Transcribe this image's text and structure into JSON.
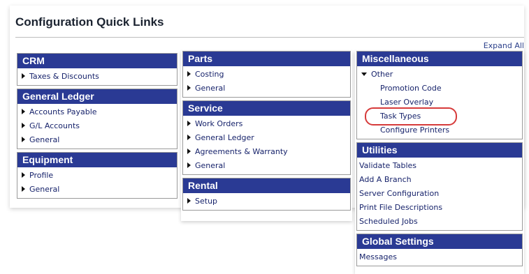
{
  "page": {
    "title": "Configuration Quick Links",
    "expand_all": "Expand All"
  },
  "sections": {
    "crm": {
      "title": "CRM",
      "items": [
        "Taxes & Discounts"
      ]
    },
    "general_ledger": {
      "title": "General Ledger",
      "items": [
        "Accounts Payable",
        "G/L Accounts",
        "General"
      ]
    },
    "equipment": {
      "title": "Equipment",
      "items": [
        "Profile",
        "General"
      ]
    },
    "parts": {
      "title": "Parts",
      "items": [
        "Costing",
        "General"
      ]
    },
    "service": {
      "title": "Service",
      "items": [
        "Work Orders",
        "General Ledger",
        "Agreements & Warranty",
        "General"
      ]
    },
    "rental": {
      "title": "Rental",
      "items": [
        "Setup"
      ]
    },
    "miscellaneous": {
      "title": "Miscellaneous",
      "group": "Other",
      "items": [
        "Promotion Code",
        "Laser Overlay",
        "Task Types",
        "Configure Printers"
      ]
    },
    "utilities": {
      "title": "Utilities",
      "items": [
        "Validate Tables",
        "Add A Branch",
        "Server Configuration",
        "Print File Descriptions",
        "Scheduled Jobs"
      ]
    },
    "global_settings": {
      "title": "Global Settings",
      "items": [
        "Messages"
      ]
    }
  },
  "colors": {
    "section_header": "#2a3a94",
    "link": "#17236b",
    "highlight": "#d63a3a"
  },
  "icons": {
    "collapsed": "caret-right-icon",
    "expanded": "caret-down-icon"
  }
}
